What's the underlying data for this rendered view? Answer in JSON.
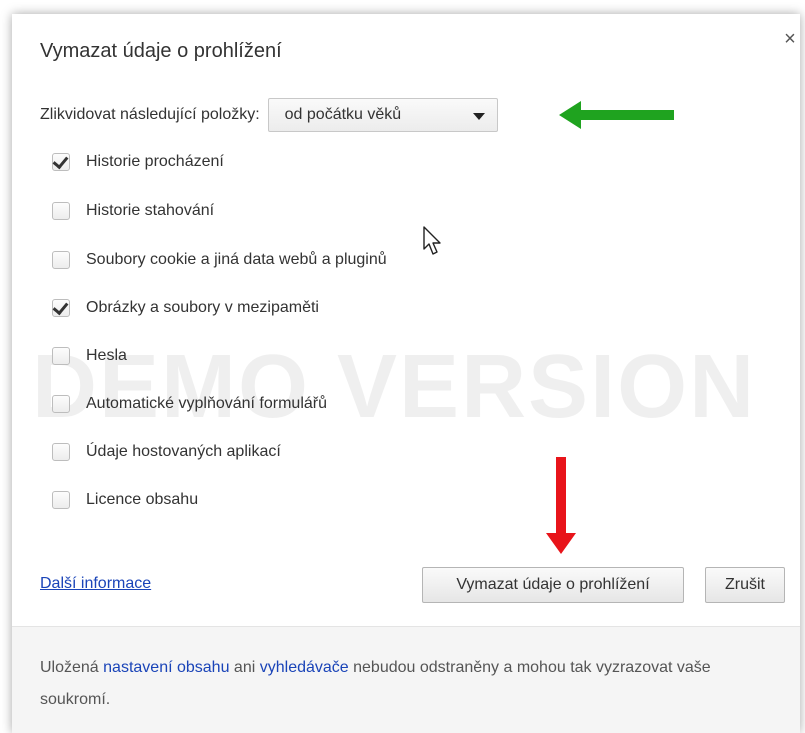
{
  "dialog": {
    "title": "Vymazat údaje o prohlížení",
    "close_icon": "close-icon",
    "close_glyph": "×"
  },
  "range": {
    "label": "Zlikvidovat následující položky:",
    "selected": "od počátku věků"
  },
  "items": [
    {
      "label": "Historie procházení",
      "checked": true
    },
    {
      "label": "Historie stahování",
      "checked": false
    },
    {
      "label": "Soubory cookie a jiná data webů a pluginů",
      "checked": false
    },
    {
      "label": "Obrázky a soubory v mezipaměti",
      "checked": true
    },
    {
      "label": "Hesla",
      "checked": false
    },
    {
      "label": "Automatické vyplňování formulářů",
      "checked": false
    },
    {
      "label": "Údaje hostovaných aplikací",
      "checked": false
    },
    {
      "label": "Licence obsahu",
      "checked": false
    }
  ],
  "more_info_link": "Další informace",
  "buttons": {
    "clear": "Vymazat údaje o prohlížení",
    "cancel": "Zrušit"
  },
  "footer": {
    "prefix": "Uložená ",
    "link1": "nastavení obsahu",
    "middle": " ani ",
    "link2": "vyhledávače",
    "suffix": " nebudou odstraněny a mohou tak vyzrazovat vaše soukromí."
  },
  "watermark": "DEMO VERSION",
  "colors": {
    "link": "#1a44b8",
    "green_arrow": "#1fa31f",
    "red_arrow": "#e8141a"
  }
}
